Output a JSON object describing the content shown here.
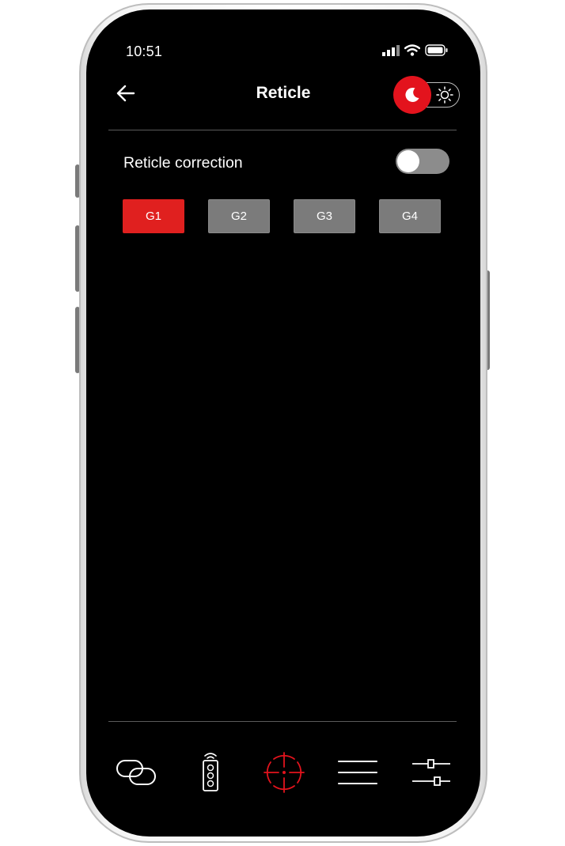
{
  "status_bar": {
    "time": "10:51",
    "icons": [
      "cellular-signal-icon",
      "wifi-icon",
      "battery-icon"
    ]
  },
  "header": {
    "back_icon": "arrow-left-icon",
    "title": "Reticle",
    "theme_toggle": {
      "mode": "night",
      "knob_icon": "moon-icon",
      "alt_icon": "sun-icon"
    }
  },
  "settings": {
    "reticle_correction": {
      "label": "Reticle correction",
      "enabled": false
    },
    "groups": [
      {
        "label": "G1",
        "active": true
      },
      {
        "label": "G2",
        "active": false
      },
      {
        "label": "G3",
        "active": false
      },
      {
        "label": "G4",
        "active": false
      }
    ]
  },
  "bottom_nav": {
    "items": [
      {
        "icon": "link-icon",
        "active": false
      },
      {
        "icon": "remote-control-icon",
        "active": false
      },
      {
        "icon": "reticle-crosshair-icon",
        "active": true
      },
      {
        "icon": "menu-lines-icon",
        "active": false
      },
      {
        "icon": "settings-sliders-icon",
        "active": false
      }
    ]
  },
  "colors": {
    "accent": "#e3131d",
    "background": "#000000",
    "inactive_button": "#7b7b7b",
    "switch_off_track": "#8c8c8c",
    "divider": "#5a5a5a"
  }
}
